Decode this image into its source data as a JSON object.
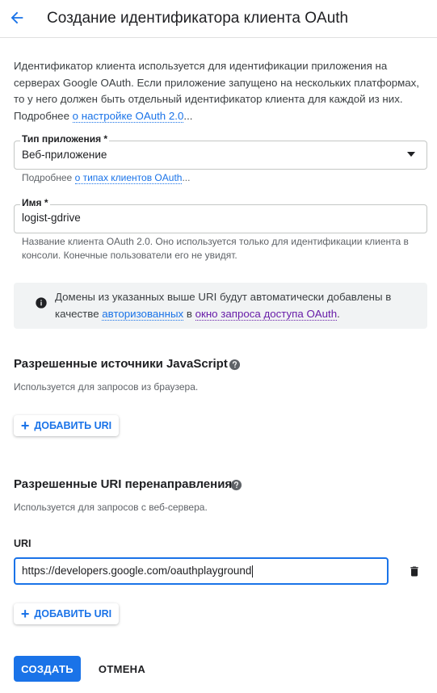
{
  "header": {
    "title": "Создание идентификатора клиента OAuth"
  },
  "intro": {
    "text": "Идентификатор клиента используется для идентификации приложения на серверах Google OAuth. Если приложение запущено на нескольких платформах, то у него должен быть отдельный идентификатор клиента для каждой из них. Подробнее ",
    "link": "о настройке OAuth 2.0",
    "suffix": "..."
  },
  "app_type": {
    "label": "Тип приложения *",
    "value": "Веб-приложение",
    "hint_prefix": "Подробнее ",
    "hint_link": "о типах клиентов OAuth",
    "hint_suffix": "..."
  },
  "name_field": {
    "label": "Имя *",
    "value": "logist-gdrive",
    "hint": "Название клиента OAuth 2.0. Оно используется только для идентификации клиента в консоли. Конечные пользователи его не увидят."
  },
  "info": {
    "text_before": "Домены из указанных выше URI будут автоматически добавлены в качестве ",
    "link1": "авторизованных",
    "middle": " в ",
    "link2": "окно запроса доступа OAuth",
    "end": "."
  },
  "js_origins": {
    "heading": "Разрешенные источники JavaScript",
    "subtitle": "Используется для запросов из браузера.",
    "add_label": "ДОБАВИТЬ URI"
  },
  "redirect": {
    "heading": "Разрешенные URI перенаправления",
    "subtitle": "Используется для запросов с веб-сервера.",
    "uri_label": "URI",
    "uri_value": "https://developers.google.com/oauthplayground",
    "add_label": "ДОБАВИТЬ URI"
  },
  "actions": {
    "create": "СОЗДАТЬ",
    "cancel": "ОТМЕНА"
  },
  "icons": {
    "back": "arrow-back-icon",
    "dropdown": "dropdown-arrow-icon",
    "info": "info-icon",
    "help": "help-icon",
    "delete": "trash-icon",
    "add": "plus-icon"
  },
  "colors": {
    "accent": "#1a73e8",
    "visited_link": "#681da8",
    "info_bg": "#f1f3f4"
  }
}
